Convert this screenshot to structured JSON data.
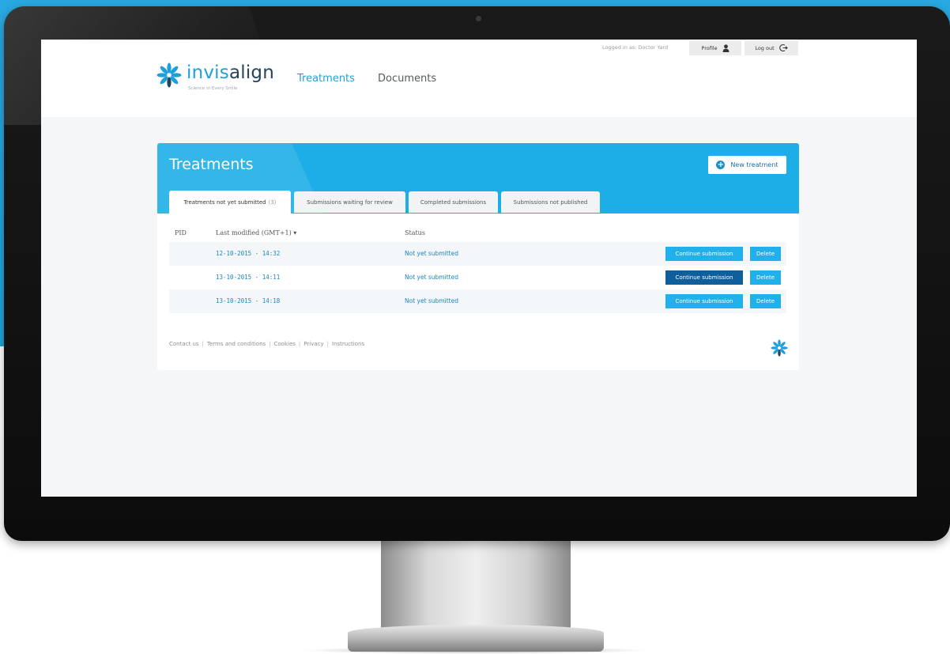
{
  "brand": {
    "name_part1": "invis",
    "name_part2": "align",
    "tagline": "Science in Every Smile"
  },
  "nav": {
    "items": [
      {
        "label": "Treatments",
        "active": true
      },
      {
        "label": "Documents",
        "active": false
      }
    ]
  },
  "user_bar": {
    "logged_in_text": "Logged in as: Doctor Yard",
    "profile_label": "Profile",
    "logout_label": "Log out"
  },
  "panel": {
    "title": "Treatments",
    "new_button_label": "New treatment",
    "tabs": [
      {
        "label": "Treatments not yet submitted",
        "count": "(3)",
        "active": true
      },
      {
        "label": "Submissions waiting for review",
        "count": "",
        "active": false
      },
      {
        "label": "Completed submissions",
        "count": "",
        "active": false
      },
      {
        "label": "Submissions not published",
        "count": "",
        "active": false
      }
    ],
    "columns": {
      "pid": "PID",
      "last_modified": "Last modified (GMT+1) ▾",
      "status": "Status"
    },
    "rows": [
      {
        "pid": "",
        "date": "12-10-2015 - 14:32",
        "status": "Not yet submitted",
        "continue": "Continue submission",
        "delete": "Delete"
      },
      {
        "pid": "",
        "date": "13-10-2015 - 14:11",
        "status": "Not yet submitted",
        "continue": "Continue submission",
        "delete": "Delete"
      },
      {
        "pid": "",
        "date": "13-10-2015 - 14:18",
        "status": "Not yet submitted",
        "continue": "Continue submission",
        "delete": "Delete"
      }
    ]
  },
  "footer": {
    "links": [
      "Contact us",
      "Terms and conditions",
      "Cookies",
      "Privacy",
      "Instructions"
    ],
    "separator": "|"
  },
  "icons": {
    "logo": "invisalign-star-icon",
    "profile": "user-icon",
    "logout": "logout-icon",
    "new": "plus-circle-icon"
  },
  "colors": {
    "brand_blue": "#1e9fd8",
    "brand_navy": "#26435f",
    "panel_header": "#1daee7",
    "button": "#22b0ea",
    "button_active": "#0e5f9c"
  }
}
